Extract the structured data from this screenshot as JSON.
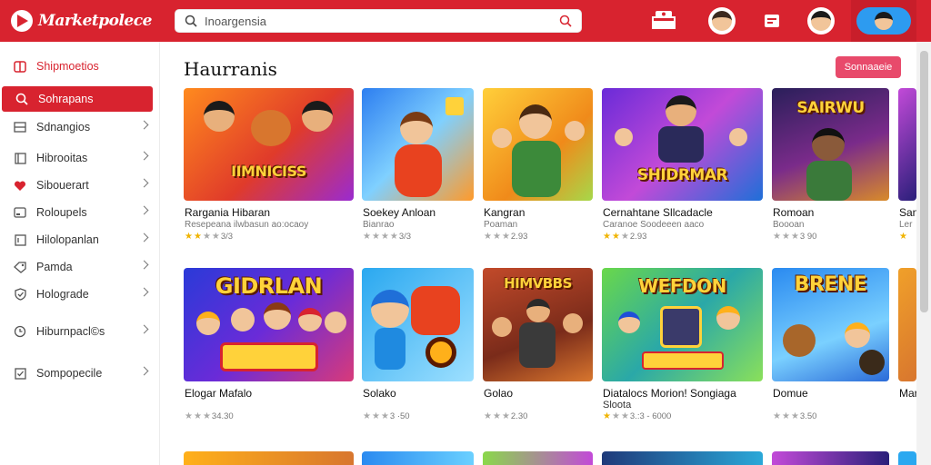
{
  "app": {
    "title": "Marketpolece",
    "accent": "#d8232f"
  },
  "search": {
    "value": "Inoargensia"
  },
  "sidebar": {
    "items": [
      {
        "label": "Shipmoetios",
        "icon": "store-icon"
      },
      {
        "label": "Sohrapans",
        "icon": "search-icon",
        "active": true
      },
      {
        "label": "Sdnangios",
        "icon": "list-icon"
      },
      {
        "label": "Hibrooitas",
        "icon": "book-icon"
      },
      {
        "label": "Sibouerart",
        "icon": "heart-icon"
      },
      {
        "label": "Roloupels",
        "icon": "card-icon"
      },
      {
        "label": "Hilolopanlan",
        "icon": "bookmark-icon"
      },
      {
        "label": "Pamda",
        "icon": "tag-icon"
      },
      {
        "label": "Holograde",
        "icon": "shield-icon"
      },
      {
        "label": "Hiburnpacl©s",
        "icon": "clock-icon"
      },
      {
        "label": "Sompopecile",
        "icon": "check-icon"
      }
    ]
  },
  "main": {
    "title": "Haurranis",
    "button_label": "Sonnaaeie",
    "row1": [
      {
        "title": "Rargania Hibaran",
        "sub": "Resepeana ilwbasun ao:ocaoy",
        "rating": "3/3",
        "stars": 2,
        "art": "IIMNICISS"
      },
      {
        "title": "Soekey Anloan",
        "sub": "Bianrao",
        "rating": "3/3",
        "stars": 0,
        "art": ""
      },
      {
        "title": "Kangran",
        "sub": "Poaman",
        "rating": "2.93",
        "stars": 0,
        "art": ""
      },
      {
        "title": "Cernahtane Sllcadacle",
        "sub": "Caranoe Soodeeen aaco",
        "rating": "2.93",
        "stars": 2,
        "art": "SHIDRMAR"
      },
      {
        "title": "Romoan",
        "sub": "Boooan",
        "rating": "3 90",
        "stars": 0,
        "art": "SAIRWU"
      },
      {
        "title": "San",
        "sub": "Ler",
        "rating": "",
        "stars": 1,
        "art": ""
      }
    ],
    "row2": [
      {
        "title": "Elogar Mafalo",
        "sub": "",
        "rating": "34.30",
        "stars": 0,
        "art": "GIDRLAN"
      },
      {
        "title": "Solako",
        "sub": "",
        "rating": "3 ·50",
        "stars": 0,
        "art": ""
      },
      {
        "title": "Golao",
        "sub": "",
        "rating": "2.30",
        "stars": 0,
        "art": "HIMVBBS"
      },
      {
        "title": "Diatalocs Morion! Songiaga",
        "sub": "Sloota",
        "rating": "3.:3 - 6000",
        "stars": 0,
        "art": "WEFDON"
      },
      {
        "title": "Domue",
        "sub": "",
        "rating": "3.50",
        "stars": 0,
        "art": "BRENE"
      },
      {
        "title": "Mar",
        "sub": "",
        "rating": "",
        "stars": 0,
        "art": ""
      }
    ]
  },
  "colors": {
    "brand": "#d8232f",
    "button": "#e84a6b",
    "star": "#f0b400"
  }
}
